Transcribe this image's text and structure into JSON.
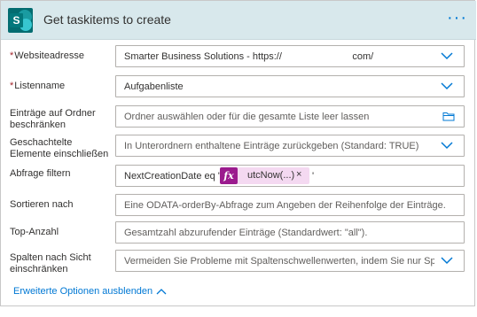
{
  "header": {
    "title": "Get taskitems to create",
    "more_glyph": "···",
    "logo_letter": "S"
  },
  "fields": [
    {
      "label": "Websiteadresse",
      "required": true,
      "required_mark": "*",
      "value": "Smarter Business Solutions - https://                          com/",
      "type": "dropdown"
    },
    {
      "label": "Listenname",
      "required": true,
      "required_mark": "*",
      "value": "Aufgabenliste",
      "type": "dropdown"
    },
    {
      "label": "Einträge auf Ordner beschränken",
      "required": false,
      "placeholder": "Ordner auswählen oder für die gesamte Liste leer lassen",
      "type": "folder-picker"
    },
    {
      "label": "Geschachtelte Elemente einschließen",
      "required": false,
      "placeholder": "In Unterordnern enthaltene Einträge zurückgeben (Standard: TRUE)",
      "type": "dropdown"
    },
    {
      "label": "Abfrage filtern",
      "required": false,
      "value": "NextCreationDate eq '",
      "token": {
        "icon": "fx",
        "label": "utcNow(...)",
        "remove": "×"
      },
      "suffix": "'",
      "type": "expression"
    },
    {
      "label": "Sortieren nach",
      "required": false,
      "placeholder": "Eine ODATA-orderBy-Abfrage zum Angeben der Reihenfolge der Einträge.",
      "type": "text"
    },
    {
      "label": "Top-Anzahl",
      "required": false,
      "placeholder": "Gesamtzahl abzurufender Einträge (Standardwert: \"all\").",
      "type": "text"
    },
    {
      "label": "Spalten nach Sicht einschränken",
      "required": false,
      "placeholder": "Vermeiden Sie Probleme mit Spaltenschwellenwerten, indem Sie nur Spal",
      "type": "dropdown"
    }
  ],
  "footer": {
    "advanced_label": "Erweiterte Optionen ausblenden"
  },
  "colors": {
    "accent": "#0078d4",
    "header_bg": "#d8e8ec",
    "required": "#a4262c",
    "fx": "#9b1b8e",
    "token_bg": "#f4d9f1"
  }
}
